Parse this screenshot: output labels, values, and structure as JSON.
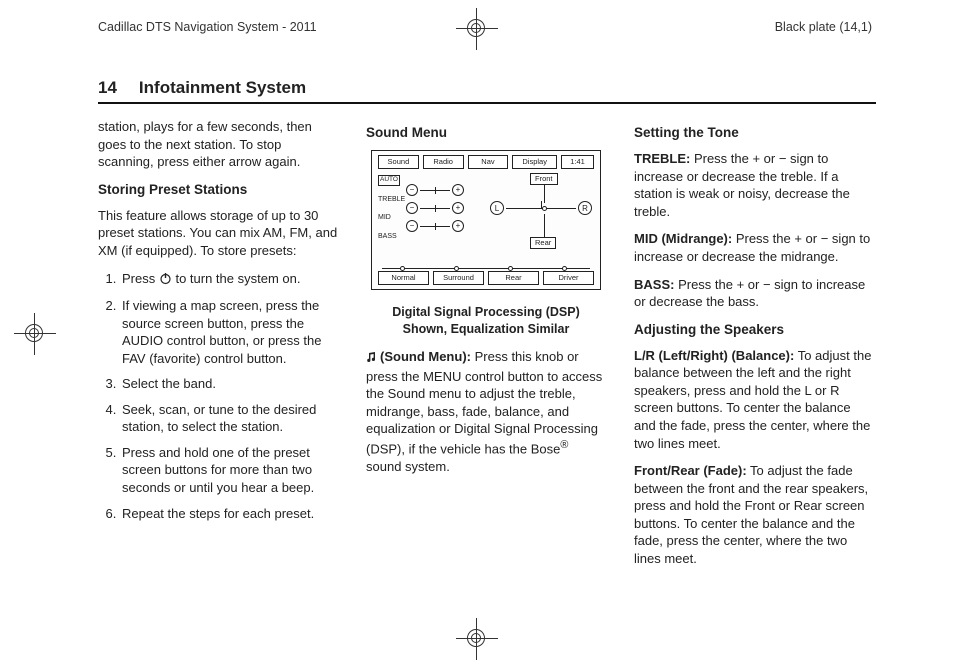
{
  "top": {
    "left": "Cadillac DTS Navigation System - 2011",
    "right": "Black plate (14,1)"
  },
  "header": {
    "page_no": "14",
    "section": "Infotainment System"
  },
  "col1": {
    "intro": "station, plays for a few seconds, then goes to the next station. To stop scanning, press either arrow again.",
    "h_storing": "Storing Preset Stations",
    "storing_intro": "This feature allows storage of up to 30 preset stations. You can mix AM, FM, and XM (if equipped). To store presets:",
    "steps": [
      {
        "pre": "Press ",
        "post": " to turn the system on."
      },
      {
        "text": "If viewing a map screen, press the source screen button, press the AUDIO control button, or press the FAV (favorite) control button."
      },
      {
        "text": "Select the band."
      },
      {
        "text": "Seek, scan, or tune to the desired station, to select the station."
      },
      {
        "text": "Press and hold one of the preset screen buttons for more than two seconds or until you hear a beep."
      },
      {
        "text": "Repeat the steps for each preset."
      }
    ]
  },
  "col2": {
    "h_sound": "Sound Menu",
    "diagram": {
      "tabs": [
        "Sound",
        "Radio",
        "Nav",
        "Display",
        "1:41"
      ],
      "left_labels": [
        "AUTO",
        "TREBLE",
        "MID",
        "BASS"
      ],
      "front": "Front",
      "rear": "Rear",
      "L": "L",
      "R": "R",
      "bottom": [
        "Normal",
        "Surround",
        "Rear",
        "Driver"
      ]
    },
    "caption_l1": "Digital Signal Processing (DSP)",
    "caption_l2": "Shown, Equalization Similar",
    "sound_label": "(Sound Menu):",
    "sound_body": "  Press this knob or press the MENU control button to access the Sound menu to adjust the treble, midrange, bass, fade, balance, and equalization or Digital Signal Processing (DSP), if the vehicle has the Bose",
    "sound_tail": " sound system."
  },
  "col3": {
    "h_tone": "Setting the Tone",
    "treble_label": "TREBLE:",
    "treble_body": "  Press the + or − sign to increase or decrease the treble. If a station is weak or noisy, decrease the treble.",
    "mid_label": "MID (Midrange):",
    "mid_body": "  Press the + or − sign to increase or decrease the midrange.",
    "bass_label": "BASS:",
    "bass_body": "  Press the + or − sign to increase or decrease the bass.",
    "h_speakers": "Adjusting the Speakers",
    "lr_label": "L/R (Left/Right) (Balance):",
    "lr_body": "  To adjust the balance between the left and the right speakers, press and hold the L or R screen buttons. To center the balance and the fade, press the center, where the two lines meet.",
    "fr_label": "Front/Rear (Fade):",
    "fr_body": "  To adjust the fade between the front and the rear speakers, press and hold the Front or Rear screen buttons. To center the balance and the fade, press the center, where the two lines meet."
  }
}
